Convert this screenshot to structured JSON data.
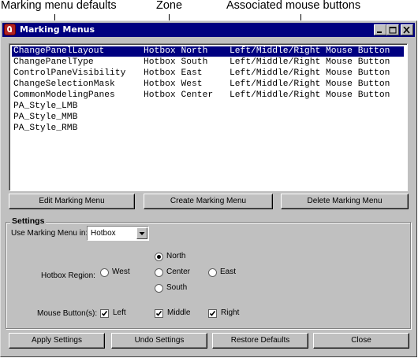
{
  "callouts": {
    "marking_menu_defaults": "Marking menu defaults",
    "zone": "Zone",
    "associated_mouse_buttons": "Associated mouse buttons"
  },
  "window": {
    "title": "Marking Menus",
    "icons": {
      "app": "maya-app-icon",
      "minimize": "minimize-icon",
      "maximize": "maximize-icon",
      "close": "close-icon"
    }
  },
  "list": {
    "rows": [
      {
        "name": "ChangePanelLayout",
        "zone": "Hotbox North",
        "buttons": "Left/Middle/Right Mouse Button"
      },
      {
        "name": "ChangePanelType",
        "zone": "Hotbox South",
        "buttons": "Left/Middle/Right Mouse Button"
      },
      {
        "name": "ControlPaneVisibility",
        "zone": "Hotbox East",
        "buttons": "Left/Middle/Right Mouse Button"
      },
      {
        "name": "ChangeSelectionMask",
        "zone": "Hotbox West",
        "buttons": "Left/Middle/Right Mouse Button"
      },
      {
        "name": "CommonModelingPanes",
        "zone": "Hotbox Center",
        "buttons": "Left/Middle/Right Mouse Button"
      },
      {
        "name": "PA_Style_LMB",
        "zone": "",
        "buttons": ""
      },
      {
        "name": "PA_Style_MMB",
        "zone": "",
        "buttons": ""
      },
      {
        "name": "PA_Style_RMB",
        "zone": "",
        "buttons": ""
      }
    ]
  },
  "actions": {
    "edit": "Edit Marking Menu",
    "create": "Create Marking Menu",
    "delete": "Delete Marking Menu"
  },
  "settings": {
    "title": "Settings",
    "use_in_label": "Use Marking Menu in:",
    "use_in_value": "Hotbox",
    "hotbox_region_label": "Hotbox Region:",
    "regions": {
      "north": "North",
      "west": "West",
      "center": "Center",
      "east": "East",
      "south": "South"
    },
    "selected_region": "North",
    "mouse_buttons_label": "Mouse Button(s):",
    "mouse_buttons": {
      "left": "Left",
      "middle": "Middle",
      "right": "Right"
    },
    "mouse_buttons_checked": [
      true,
      true,
      true
    ]
  },
  "footer": {
    "apply": "Apply Settings",
    "undo": "Undo Settings",
    "restore": "Restore Defaults",
    "close": "Close"
  },
  "colors": {
    "selection": "#000080",
    "titlebar": "#000080",
    "face": "#c0c0c0"
  }
}
